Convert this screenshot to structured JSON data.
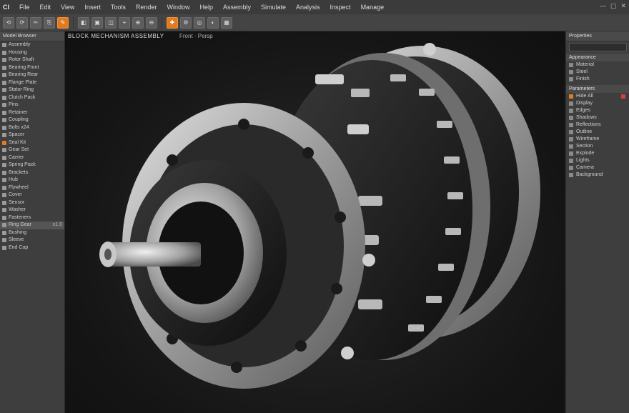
{
  "app": {
    "brand": "CI"
  },
  "menu": [
    "File",
    "Edit",
    "View",
    "Insert",
    "Tools",
    "Render",
    "Window",
    "Help",
    "Assembly",
    "Simulate",
    "Analysis",
    "Inspect",
    "Manage"
  ],
  "window_controls": [
    "—",
    "▢",
    "✕"
  ],
  "toolbar": {
    "buttons": [
      "⟲",
      "⟳",
      "✂",
      "⎘",
      "✎",
      "◧",
      "▣",
      "◫",
      "⌖",
      "⊕",
      "⊖",
      "✚",
      "⚙",
      "◎",
      "◐",
      "▦"
    ],
    "accent_buttons": [
      4,
      11
    ],
    "accent_color": "#e07b1f"
  },
  "left_panel": {
    "header": "Model Browser",
    "items": [
      {
        "label": "Assembly"
      },
      {
        "label": "Housing"
      },
      {
        "label": "Rotor Shaft"
      },
      {
        "label": "Bearing Front"
      },
      {
        "label": "Bearing Rear"
      },
      {
        "label": "Flange Plate"
      },
      {
        "label": "Stator Ring"
      },
      {
        "label": "Clutch Pack"
      },
      {
        "label": "Pins"
      },
      {
        "label": "Retainer"
      },
      {
        "label": "Coupling"
      },
      {
        "label": "Bolts x24"
      },
      {
        "label": "Spacer"
      },
      {
        "label": "Seal Kit",
        "hl": true
      },
      {
        "label": "Gear Set"
      },
      {
        "label": "Carrier"
      },
      {
        "label": "Spring Pack"
      },
      {
        "label": "Brackets"
      },
      {
        "label": "Hub"
      },
      {
        "label": "Flywheel"
      },
      {
        "label": "Cover"
      },
      {
        "label": "Sensor"
      },
      {
        "label": "Washer"
      },
      {
        "label": "Fasteners"
      },
      {
        "label": "Ring Gear",
        "val": "x1.0",
        "sel": true
      },
      {
        "label": "Bushing"
      },
      {
        "label": "Sleeve"
      },
      {
        "label": "End Cap"
      }
    ]
  },
  "viewport": {
    "label": "BLOCK MECHANISM ASSEMBLY",
    "label2": "Front · Persp"
  },
  "right_panel": {
    "header": "Properties",
    "sections": [
      {
        "title": "Appearance",
        "rows": [
          {
            "label": "Material"
          },
          {
            "label": "Steel"
          },
          {
            "label": "Finish"
          }
        ]
      },
      {
        "title": "Parameters",
        "rows": [
          {
            "label": "Hide All",
            "hl": true
          },
          {
            "label": "Display"
          },
          {
            "label": "Edges"
          },
          {
            "label": "Shadows"
          },
          {
            "label": "Reflections"
          },
          {
            "label": "Outline"
          },
          {
            "label": "Wireframe"
          },
          {
            "label": "Section"
          },
          {
            "label": "Explode"
          },
          {
            "label": "Lights"
          },
          {
            "label": "Camera"
          },
          {
            "label": "Background"
          }
        ]
      }
    ]
  }
}
